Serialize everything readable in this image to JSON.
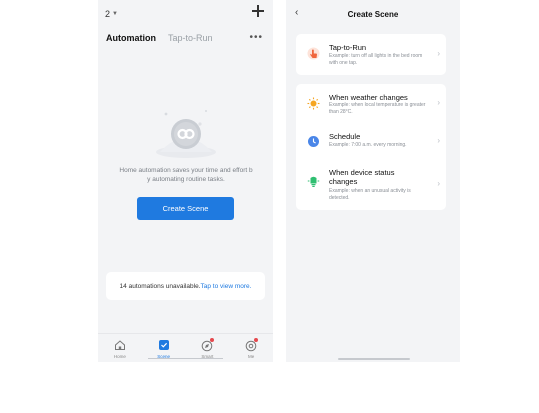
{
  "left": {
    "home_selector": "2",
    "tabs": [
      {
        "label": "Automation",
        "active": true
      },
      {
        "label": "Tap-to-Run",
        "active": false
      }
    ],
    "empty_message": "Home automation saves your time and effort b\ny automating routine tasks.",
    "create_button": "Create Scene",
    "notice": {
      "text": "14 automations unavailable.",
      "link": "Tap to view more."
    },
    "nav": [
      {
        "label": "Home",
        "icon": "house-icon",
        "active": false
      },
      {
        "label": "Scene",
        "icon": "checkbox-icon",
        "active": true
      },
      {
        "label": "Smart",
        "icon": "compass-icon",
        "active": false
      },
      {
        "label": "Me",
        "icon": "gear-icon",
        "active": false
      }
    ]
  },
  "right": {
    "title": "Create Scene",
    "items": [
      {
        "title": "Tap-to-Run",
        "desc": "Example: turn off all lights in the bed room with one tap.",
        "icon": "tap-hand-icon",
        "color": "#f0663d"
      },
      {
        "title": "When weather changes",
        "desc": "Example: when local temperature is greater than 28°C.",
        "icon": "sun-icon",
        "color": "#f5a623"
      },
      {
        "title": "Schedule",
        "desc": "Example: 7:00 a.m. every morning.",
        "icon": "clock-icon",
        "color": "#4a86e8"
      },
      {
        "title": "When device status changes",
        "desc": "Example: when an unusual activity is detected.",
        "icon": "device-icon",
        "color": "#2fbf71"
      }
    ]
  },
  "colors": {
    "accent": "#1f7ae0",
    "background": "#f3f4f6",
    "badge": "#e5484d"
  }
}
